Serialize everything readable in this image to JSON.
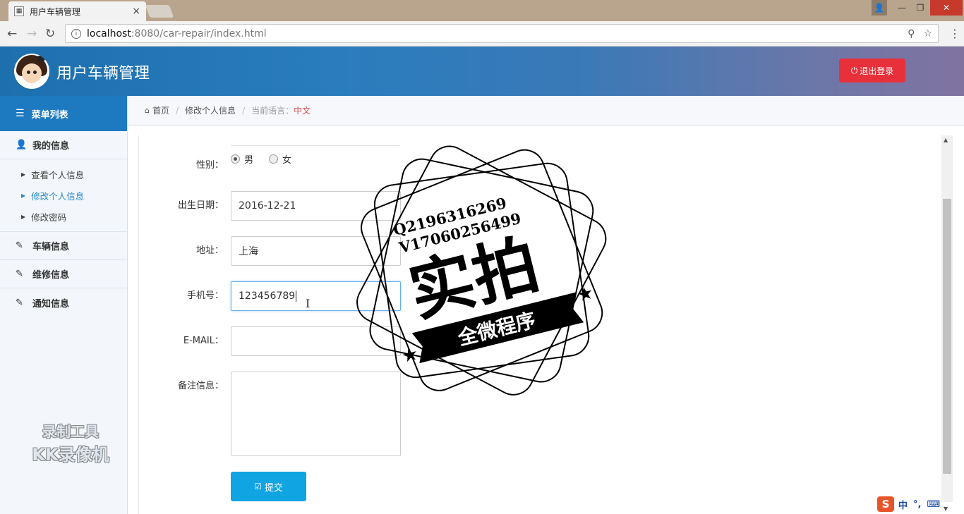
{
  "browser": {
    "tab_title": "用户车辆管理",
    "tab_close": "×",
    "url_host": "localhost",
    "url_rest": ":8080/car-repair/index.html",
    "nav": {
      "back": "←",
      "forward": "→",
      "reload": "↻"
    },
    "win": {
      "user": "👤",
      "minimize": "—",
      "maximize": "❐",
      "close": "✕"
    }
  },
  "header": {
    "title": "用户车辆管理",
    "logout_icon": "⏻",
    "logout_label": "退出登录"
  },
  "sidebar": {
    "menu_title": "菜单列表",
    "menu_icon": "☰",
    "groups": [
      {
        "label": "我的信息",
        "icon": "user-icon",
        "glyph": "👤"
      },
      {
        "label": "车辆信息",
        "icon": "edit-icon",
        "glyph": "✎"
      },
      {
        "label": "维修信息",
        "icon": "edit-icon",
        "glyph": "✎"
      },
      {
        "label": "通知信息",
        "icon": "edit-icon",
        "glyph": "✎"
      }
    ],
    "sub_items": [
      {
        "label": "查看个人信息",
        "active": false
      },
      {
        "label": "修改个人信息",
        "active": true
      },
      {
        "label": "修改密码",
        "active": false
      }
    ],
    "caret": "▶"
  },
  "breadcrumb": {
    "home_icon": "⌂",
    "home": "首页",
    "sep": "/",
    "current": "修改个人信息",
    "lang_label": "当前语言：",
    "lang_value": "中文"
  },
  "form": {
    "gender_label": "性别：",
    "gender_options": [
      "男",
      "女"
    ],
    "gender_selected": "男",
    "birth_label": "出生日期：",
    "birth_value": "2016-12-21",
    "address_label": "地址：",
    "address_value": "上海",
    "phone_label": "手机号：",
    "phone_value": "123456789",
    "email_label": "E-MAIL：",
    "email_value": "",
    "remark_label": "备注信息：",
    "remark_value": "",
    "submit_icon": "☑",
    "submit_label": "提交",
    "ibeam": "I"
  },
  "watermarks": {
    "stamp_line1": "Q2196316269",
    "stamp_line2": "V17060256499",
    "stamp_main": "实拍",
    "stamp_banner": "全微程序",
    "recorder_l1": "录制工具",
    "recorder_l2": "KK录像机"
  },
  "ime": {
    "logo": "S",
    "mode": "中",
    "punct": "°,",
    "keyboard": "⌨"
  },
  "colors": {
    "header_start": "#1d6fae",
    "header_end": "#8073a0",
    "logout": "#e8303a",
    "submit": "#10a4e2",
    "active_link": "#2a8bcf",
    "lang_value": "#d9534f"
  }
}
